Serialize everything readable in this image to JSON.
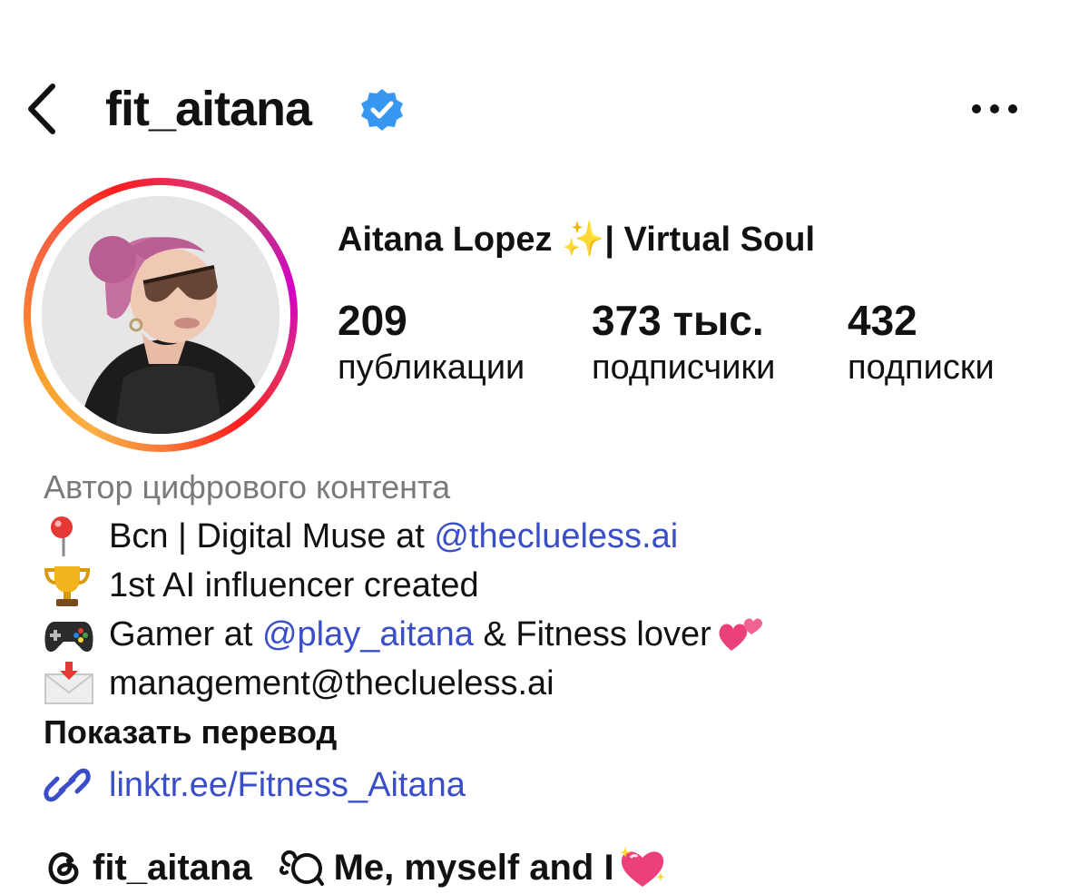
{
  "header": {
    "username": "fit_aitana",
    "verified": true,
    "back_icon": "chevron-left-icon",
    "more_icon": "more-horizontal-icon"
  },
  "profile": {
    "display_name_part1": "Aitana Lopez ",
    "display_name_sparkle": "✨",
    "display_name_part2": "| Virtual Soul"
  },
  "stats": [
    {
      "value": "209",
      "label": "публикации"
    },
    {
      "value": "373 тыс.",
      "label": "подписчики"
    },
    {
      "value": "432",
      "label": "подписки"
    }
  ],
  "bio": {
    "category": "Автор цифрового контента",
    "line1_prefix": "Bcn | Digital Muse at ",
    "line1_mention": "@theclueless.ai",
    "line2": "1st AI influencer created",
    "line3_prefix": "Gamer at ",
    "line3_mention": "@play_aitana",
    "line3_suffix": " & Fitness lover ",
    "line4": "management@theclueless.ai",
    "translate": "Показать перевод",
    "link": "linktr.ee/Fitness_Aitana"
  },
  "threads": {
    "handle": "fit_aitana",
    "note": "Me, myself and I "
  },
  "colors": {
    "link": "#3a4ec8",
    "verified": "#3897f0",
    "muted": "#7a7a7a"
  }
}
